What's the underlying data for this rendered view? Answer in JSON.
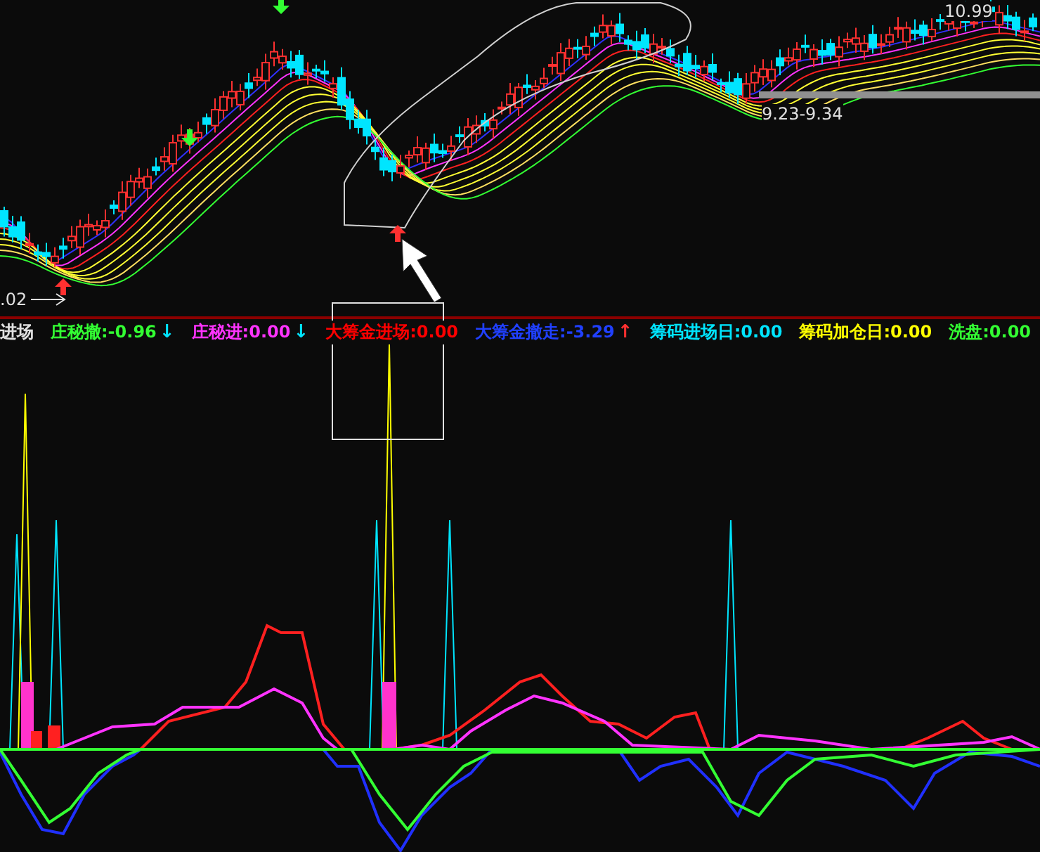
{
  "price_chart": {
    "labels": [
      {
        "kind": "low",
        "text": ".02"
      },
      {
        "kind": "range",
        "text": "9.23-9.34"
      },
      {
        "kind": "high",
        "text": "10.99"
      }
    ]
  },
  "indicator_legend": [
    {
      "text": "进场",
      "color": "#e0e0e0"
    },
    {
      "text": "庄秘撤:-0.96",
      "color": "#33ff33",
      "arrow": {
        "text": "↓",
        "color": "#00e5ff"
      }
    },
    {
      "text": "庄秘进:0.00",
      "color": "#ff33ff",
      "arrow": {
        "text": "↓",
        "color": "#00e5ff"
      }
    },
    {
      "text": "大筹金进场:0.00",
      "color": "#ff0000"
    },
    {
      "text": "大筹金撤走:-3.29",
      "color": "#2040ff",
      "arrow": {
        "text": "↑",
        "color": "#ff3030"
      }
    },
    {
      "text": "筹码进场日:0.00",
      "color": "#00e5ff"
    },
    {
      "text": "筹码加仓日:0.00",
      "color": "#ffff00"
    },
    {
      "text": "洗盘:0.00",
      "color": "#33ff33"
    }
  ]
}
